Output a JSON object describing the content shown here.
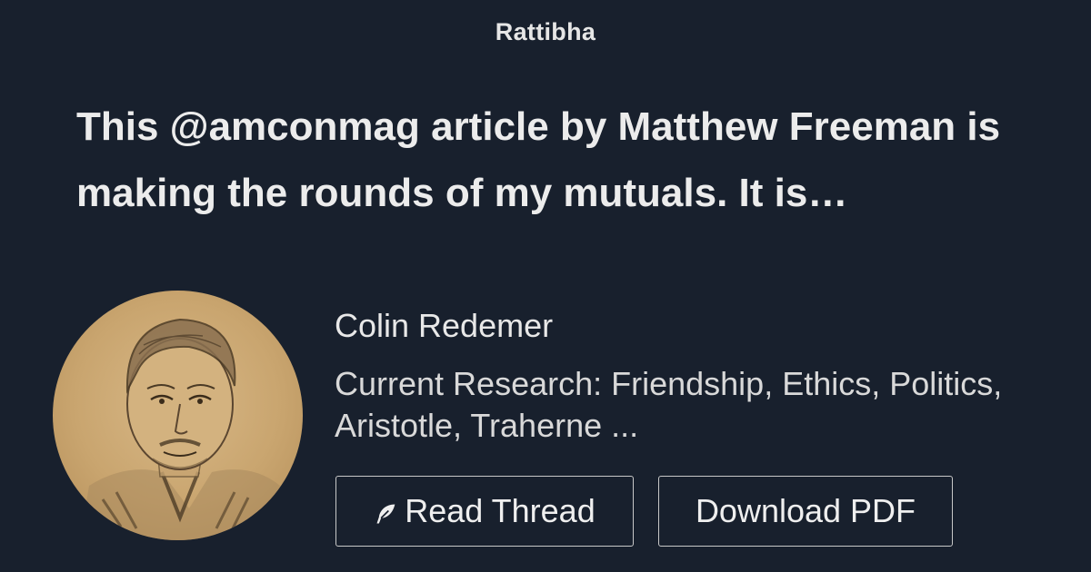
{
  "site": {
    "brand": "Rattibha"
  },
  "thread": {
    "title": "This @amconmag article by Matthew Freeman is making the rounds of my mutuals. It is…"
  },
  "author": {
    "name": "Colin Redemer",
    "bio": "Current Research: Friendship, Ethics, Politics, Aristotle, Traherne ..."
  },
  "actions": {
    "read_label": "Read Thread",
    "read_icon": "feather-icon",
    "pdf_label": "Download PDF"
  },
  "colors": {
    "background": "#18202d",
    "text": "#e8e8e8",
    "button_border": "#c8c8c8"
  }
}
